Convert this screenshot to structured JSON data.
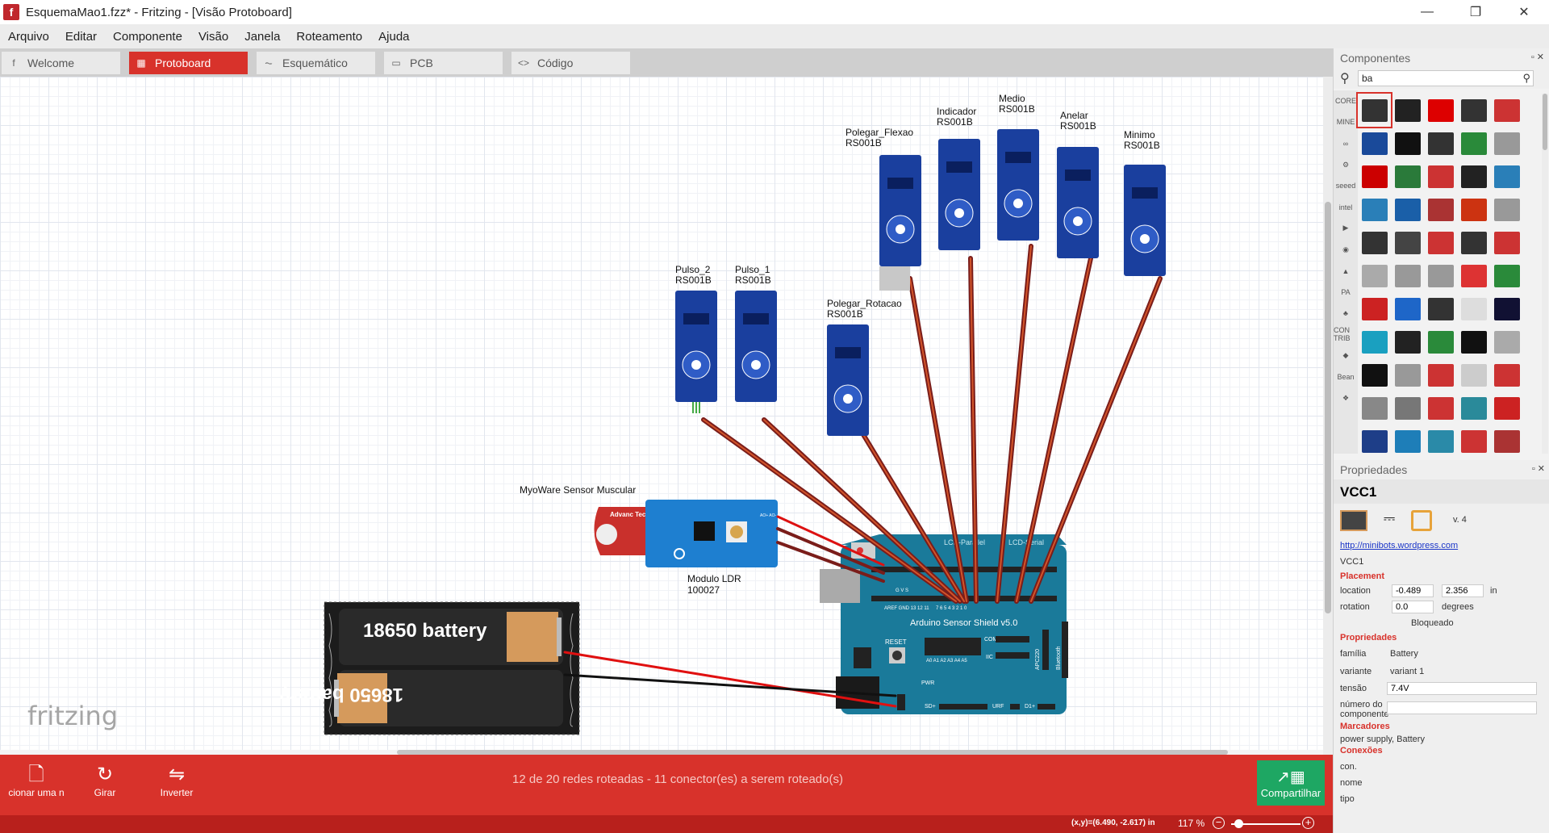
{
  "window": {
    "title": "EsquemaMao1.fzz* - Fritzing - [Visão Protoboard]",
    "app_icon": "f",
    "minimize": "—",
    "maximize": "❐",
    "close": "✕"
  },
  "menu": [
    "Arquivo",
    "Editar",
    "Componente",
    "Visão",
    "Janela",
    "Roteamento",
    "Ajuda"
  ],
  "tabs": [
    {
      "label": "Welcome",
      "icon": "fritzing-f-icon",
      "glyph": "f",
      "active": false
    },
    {
      "label": "Protoboard",
      "icon": "breadboard-icon",
      "glyph": "▦",
      "active": true
    },
    {
      "label": "Esquemático",
      "icon": "schematic-icon",
      "glyph": "⏦",
      "active": false
    },
    {
      "label": "PCB",
      "icon": "pcb-icon",
      "glyph": "▭",
      "active": false
    },
    {
      "label": "Código",
      "icon": "code-icon",
      "glyph": "<>",
      "active": false
    }
  ],
  "canvas": {
    "watermark": "fritzing",
    "servos": [
      {
        "name": "Pulso_2",
        "part": "RS001B"
      },
      {
        "name": "Pulso_1",
        "part": "RS001B"
      },
      {
        "name": "Polegar_Rotacao",
        "part": "RS001B"
      },
      {
        "name": "Polegar_Flexao",
        "part": "RS001B"
      },
      {
        "name": "Indicador",
        "part": "RS001B"
      },
      {
        "name": "Medio",
        "part": "RS001B"
      },
      {
        "name": "Anelar",
        "part": "RS001B"
      },
      {
        "name": "Minimo",
        "part": "RS001B"
      }
    ],
    "myoware_label": "MyoWare Sensor Muscular",
    "myoware_text": "Advanc Technolog",
    "ldr_label": "Modulo LDR",
    "ldr_code": "100027",
    "ldr_pins": "AO+ AO- GND",
    "battery_top": "18650 battery",
    "battery_bottom": "18650 battery",
    "shield_title": "Arduino Sensor Shield v5.0",
    "shield_lcd1": "LCD-Parallel",
    "shield_lcd2": "LCD-Serial",
    "shield_reset": "RESET",
    "shield_com": "COM",
    "shield_iic": "IIC",
    "shield_urf": "URF",
    "shield_pwr": "PWR",
    "shield_bt": "Bluetooth",
    "shield_apc": "APC220",
    "shield_sd": "SD+",
    "shield_d1": "D1+",
    "shield_aref": "AREF GND 13 12 11",
    "shield_analog": "A0 A1 A2 A3 A4 A5",
    "shield_digital": "7 6 5 4 3 2 1 0",
    "shield_gvs": "G V S"
  },
  "toolbar": {
    "buttons": [
      {
        "label": "cionar uma n",
        "icon": "add-note-icon",
        "glyph": "🗋"
      },
      {
        "label": "Girar",
        "icon": "rotate-icon",
        "glyph": "↻"
      },
      {
        "label": "Inverter",
        "icon": "flip-icon",
        "glyph": "⇋"
      }
    ],
    "routing_status": "12 de 20 redes roteadas - 11 conector(es) a serem roteado(s)",
    "share_label": "Compartilhar",
    "share_icon": "share-icon"
  },
  "statusbar": {
    "coords": "(x,y)=(6.490, -2.617) in",
    "zoom": "117 %",
    "zoom_minus": "−",
    "zoom_plus": "+",
    "zoom_fraction": 0.05
  },
  "components_panel": {
    "title": "Componentes",
    "search_value": "ba",
    "bins": [
      "CORE",
      "MINE",
      "∞",
      "⚙",
      "seeed",
      "intel",
      "▶",
      "◉",
      "▲",
      "PA",
      "♣",
      "CON TRIB",
      "◆",
      "Bean",
      "❖"
    ],
    "parts_colors": [
      "#333",
      "#222",
      "#d00",
      "#333",
      "#c33",
      "#1a4a9a",
      "#111",
      "#333",
      "#2a8a3a",
      "#999",
      "#c00",
      "#2a7a3a",
      "#c33",
      "#222",
      "#2a7fb8",
      "#2a7fb8",
      "#1a5fa8",
      "#a33",
      "#c31",
      "#999",
      "#333",
      "#444",
      "#c33",
      "#333",
      "#c33",
      "#aaa",
      "#999",
      "#999",
      "#d33",
      "#2a8a3a",
      "#c22",
      "#1e66c8",
      "#333",
      "#ddd",
      "#113",
      "#1aa0c0",
      "#222",
      "#2a8a3a",
      "#111",
      "#aaa",
      "#111",
      "#999",
      "#c33",
      "#ccc",
      "#c33",
      "#888",
      "#777",
      "#c33",
      "#2a8a9a",
      "#c22",
      "#1e3e88",
      "#1e7eb8",
      "#2a8aa8",
      "#c33",
      "#a33"
    ]
  },
  "properties_panel": {
    "title": "Propriedades",
    "part_title": "VCC1",
    "version": "v. 4",
    "url": "http://minibots.wordpress.com",
    "instance": "VCC1",
    "placement_header": "Placement",
    "location_label": "location",
    "location_x": "-0.489",
    "location_y": "2.356",
    "location_unit": "in",
    "rotation_label": "rotation",
    "rotation_value": "0.0",
    "rotation_unit": "degrees",
    "locked_label": "Bloqueado",
    "props_header": "Propriedades",
    "family_label": "família",
    "family_value": "Battery",
    "variant_label": "variante",
    "variant_value": "variant 1",
    "voltage_label": "tensão",
    "voltage_value": "7.4V",
    "partnum_label": "número do componente",
    "tags_header": "Marcadores",
    "tags_value": "power supply, Battery",
    "conn_header": "Conexões",
    "conn_label": "con.",
    "name_label": "nome",
    "type_label": "tipo"
  },
  "colors": {
    "accent": "#d8322b",
    "share": "#1ea763",
    "servo": "#1a3f9e",
    "arduino": "#1a7a9a",
    "ldr": "#1e7fd0",
    "myoware": "#c9302c"
  }
}
